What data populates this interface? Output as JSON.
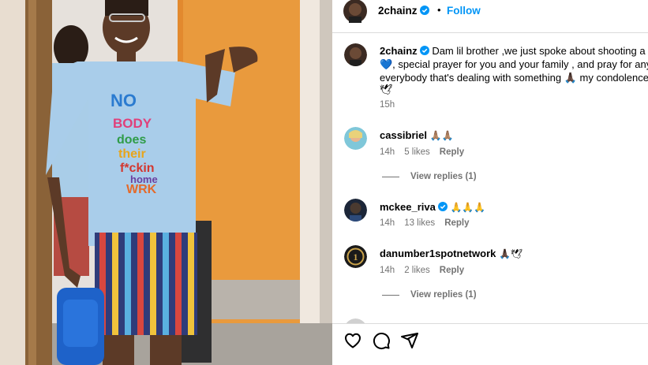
{
  "post": {
    "author": "2chainz",
    "follow_label": "Follow",
    "separator": "•"
  },
  "photo": {
    "shirt_text": [
      "NO",
      "BODY",
      "does",
      "their",
      "f*ckin",
      "home",
      "WRK"
    ]
  },
  "comments": [
    {
      "user": "2chainz",
      "verified": true,
      "lines": [
        "Dam lil brother ,we just spoke about shooting a vid",
        "💙, special prayer for you and your family , and pray for any a",
        "everybody that's dealing with something 🙏🏿 my condolences",
        "🕊"
      ],
      "time": "15h"
    },
    {
      "user": "cassibriel",
      "verified": false,
      "emoji": "🙏🏽🙏🏽",
      "time": "14h",
      "likes": "5 likes",
      "reply": "Reply",
      "view_replies": "View replies (1)"
    },
    {
      "user": "mckee_riva",
      "verified": true,
      "emoji": "🙏🙏🙏",
      "time": "14h",
      "likes": "13 likes",
      "reply": "Reply"
    },
    {
      "user": "danumber1spotnetwork",
      "verified": false,
      "emoji": "🙏🏿🕊",
      "time": "14h",
      "likes": "2 likes",
      "reply": "Reply",
      "view_replies": "View replies (1)"
    }
  ],
  "actions": {
    "like": "heart-icon",
    "comment": "comment-icon",
    "share": "share-icon"
  },
  "colors": {
    "accent": "#0095f6",
    "verified": "#0095f6",
    "meta_text": "#737373",
    "divider": "#dbdbdb"
  }
}
